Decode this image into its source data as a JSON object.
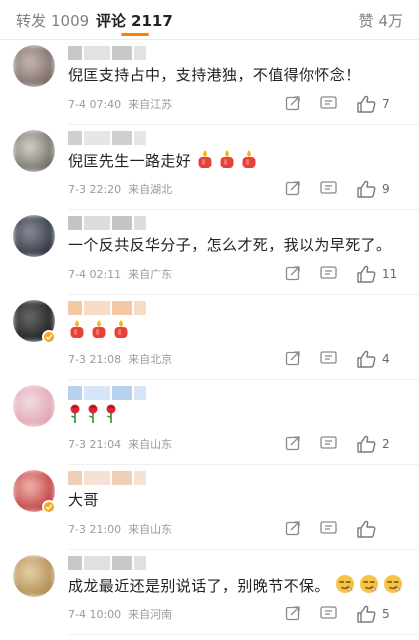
{
  "tabs": {
    "reposts": {
      "label": "转发",
      "count": "1009"
    },
    "comments": {
      "label": "评论",
      "count": "2117"
    },
    "likes": {
      "label": "赞",
      "count": "4万"
    }
  },
  "comments": [
    {
      "text": "倪匡支持占中，支持港独，不值得你怀念！",
      "time": "7-4 07:40",
      "location": "来自江苏",
      "likes": "7",
      "avatar_colors": [
        "#7a6a68",
        "#c9b8b2"
      ],
      "name_colors": [
        "#c8c8c8",
        "#e2e2e2"
      ]
    },
    {
      "text": "倪匡先生一路走好",
      "emojis": [
        "candle-icon",
        "candle-icon",
        "candle-icon"
      ],
      "time": "7-3 22:20",
      "location": "来自湖北",
      "likes": "9",
      "avatar_colors": [
        "#6e6a66",
        "#d8d4cc"
      ],
      "name_colors": [
        "#cfcfcf",
        "#e6e6e6"
      ]
    },
    {
      "text": "一个反共反华分子，怎么才死，我以为早死了。",
      "time": "7-4 02:11",
      "location": "来自广东",
      "likes": "11",
      "avatar_colors": [
        "#2f3440",
        "#8a8f9a"
      ],
      "name_colors": [
        "#c4c4c4",
        "#dcdcdc"
      ]
    },
    {
      "text": "",
      "emojis": [
        "candle-icon",
        "candle-icon",
        "candle-icon"
      ],
      "time": "7-3 21:08",
      "location": "来自北京",
      "likes": "4",
      "avatar_colors": [
        "#1d1d1d",
        "#6a6a6a"
      ],
      "name_colors": [
        "#f3c8a2",
        "#f6dcc4"
      ],
      "verified": true
    },
    {
      "text": "",
      "emojis": [
        "rose-icon",
        "rose-icon",
        "rose-icon"
      ],
      "time": "7-3 21:04",
      "location": "来自山东",
      "likes": "2",
      "avatar_colors": [
        "#e0a3b0",
        "#f4dde4"
      ],
      "name_colors": [
        "#b8d2ee",
        "#d6e6f6"
      ]
    },
    {
      "text": "大哥",
      "time": "7-3 21:00",
      "location": "来自山东",
      "likes": "",
      "avatar_colors": [
        "#c0393a",
        "#f0b8b0"
      ],
      "name_colors": [
        "#f0cfb8",
        "#f6e2d4"
      ],
      "verified": true
    },
    {
      "text": "成龙最近还是别说话了，别晚节不保。",
      "emojis": [
        "smirk-icon",
        "smirk-icon",
        "smirk-icon"
      ],
      "time": "7-4 10:00",
      "location": "来自河南",
      "likes": "5",
      "avatar_colors": [
        "#b08a52",
        "#e6d2a8"
      ],
      "name_colors": [
        "#c8c8c8",
        "#e0e0e0"
      ]
    }
  ],
  "colors": {
    "accent": "#ff8200",
    "candle": "#e8413a",
    "flame": "#ffb000",
    "rose": "#d8262c",
    "stem": "#2e8b3a",
    "smirk": "#f6c343"
  }
}
